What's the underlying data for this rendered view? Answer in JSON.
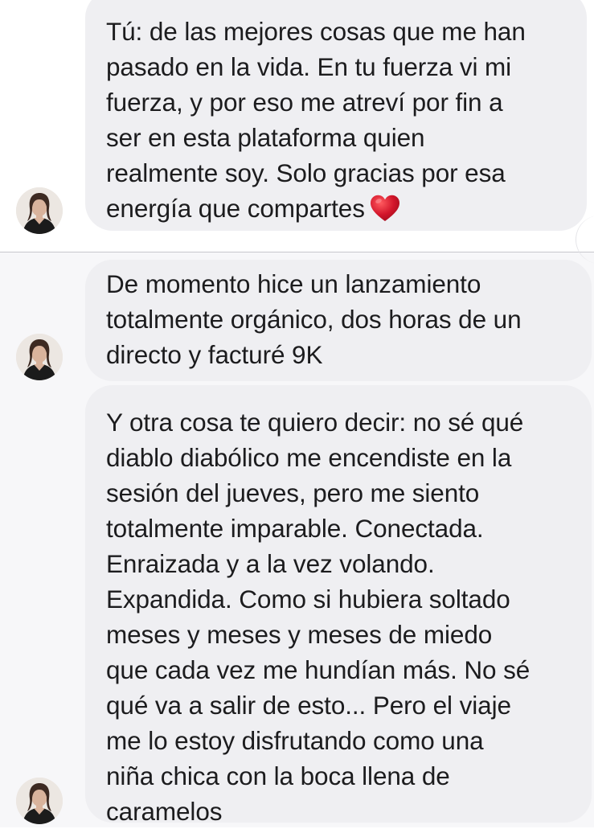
{
  "thread": {
    "messages": [
      {
        "lines": [
          "Tú: de las mejores cosas que me han",
          "pasado en la vida. En tu fuerza vi mi",
          "fuerza, y por eso me atreví por fin a",
          "ser en esta plataforma quien",
          "realmente soy. Solo gracias por esa",
          "energía que compartes"
        ],
        "trailing_icon": "red-heart-emoji"
      },
      {
        "lines": [
          "De momento hice un lanzamiento",
          "totalmente orgánico, dos horas de un",
          "directo y facturé 9K"
        ]
      },
      {
        "lines": [
          "Y otra cosa te quiero decir: no sé qué",
          "diablo diabólico me encendiste en la",
          "sesión del jueves, pero me siento",
          "totalmente imparable. Conectada.",
          "Enraizada y a la vez volando.",
          "Expandida. Como si hubiera soltado",
          "meses y meses y meses de miedo",
          "que cada vez me hundían más. No sé",
          "qué va a salir de esto... Pero el viaje",
          "me lo estoy disfrutando como una",
          "niña chica con la boca llena de",
          "caramelos"
        ]
      }
    ]
  },
  "colors": {
    "bubble": "#efeff2",
    "text": "#1c1c1e",
    "heart": "#d3162b",
    "section_background": "#f7f7f9"
  }
}
